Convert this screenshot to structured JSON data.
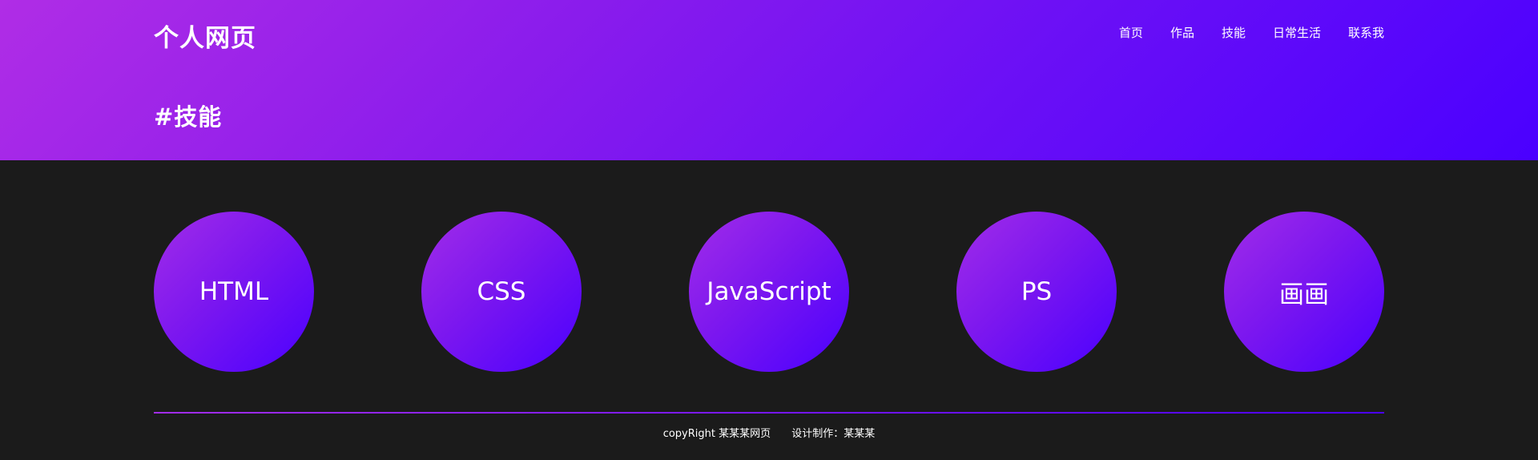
{
  "header": {
    "site_title": "个人网页",
    "section_title": "#技能",
    "nav": [
      {
        "label": "首页"
      },
      {
        "label": "作品"
      },
      {
        "label": "技能"
      },
      {
        "label": "日常生活"
      },
      {
        "label": "联系我"
      }
    ]
  },
  "skills": [
    {
      "label": "HTML"
    },
    {
      "label": "CSS"
    },
    {
      "label": "JavaScript"
    },
    {
      "label": "PS"
    },
    {
      "label": "画画"
    }
  ],
  "footer": {
    "copyright": "copyRight 某某某网页",
    "designer": "设计制作：某某某"
  },
  "colors": {
    "gradient_start": "#b02de6",
    "gradient_end": "#4a00ff",
    "background": "#1b1b1b",
    "text": "#ffffff"
  }
}
